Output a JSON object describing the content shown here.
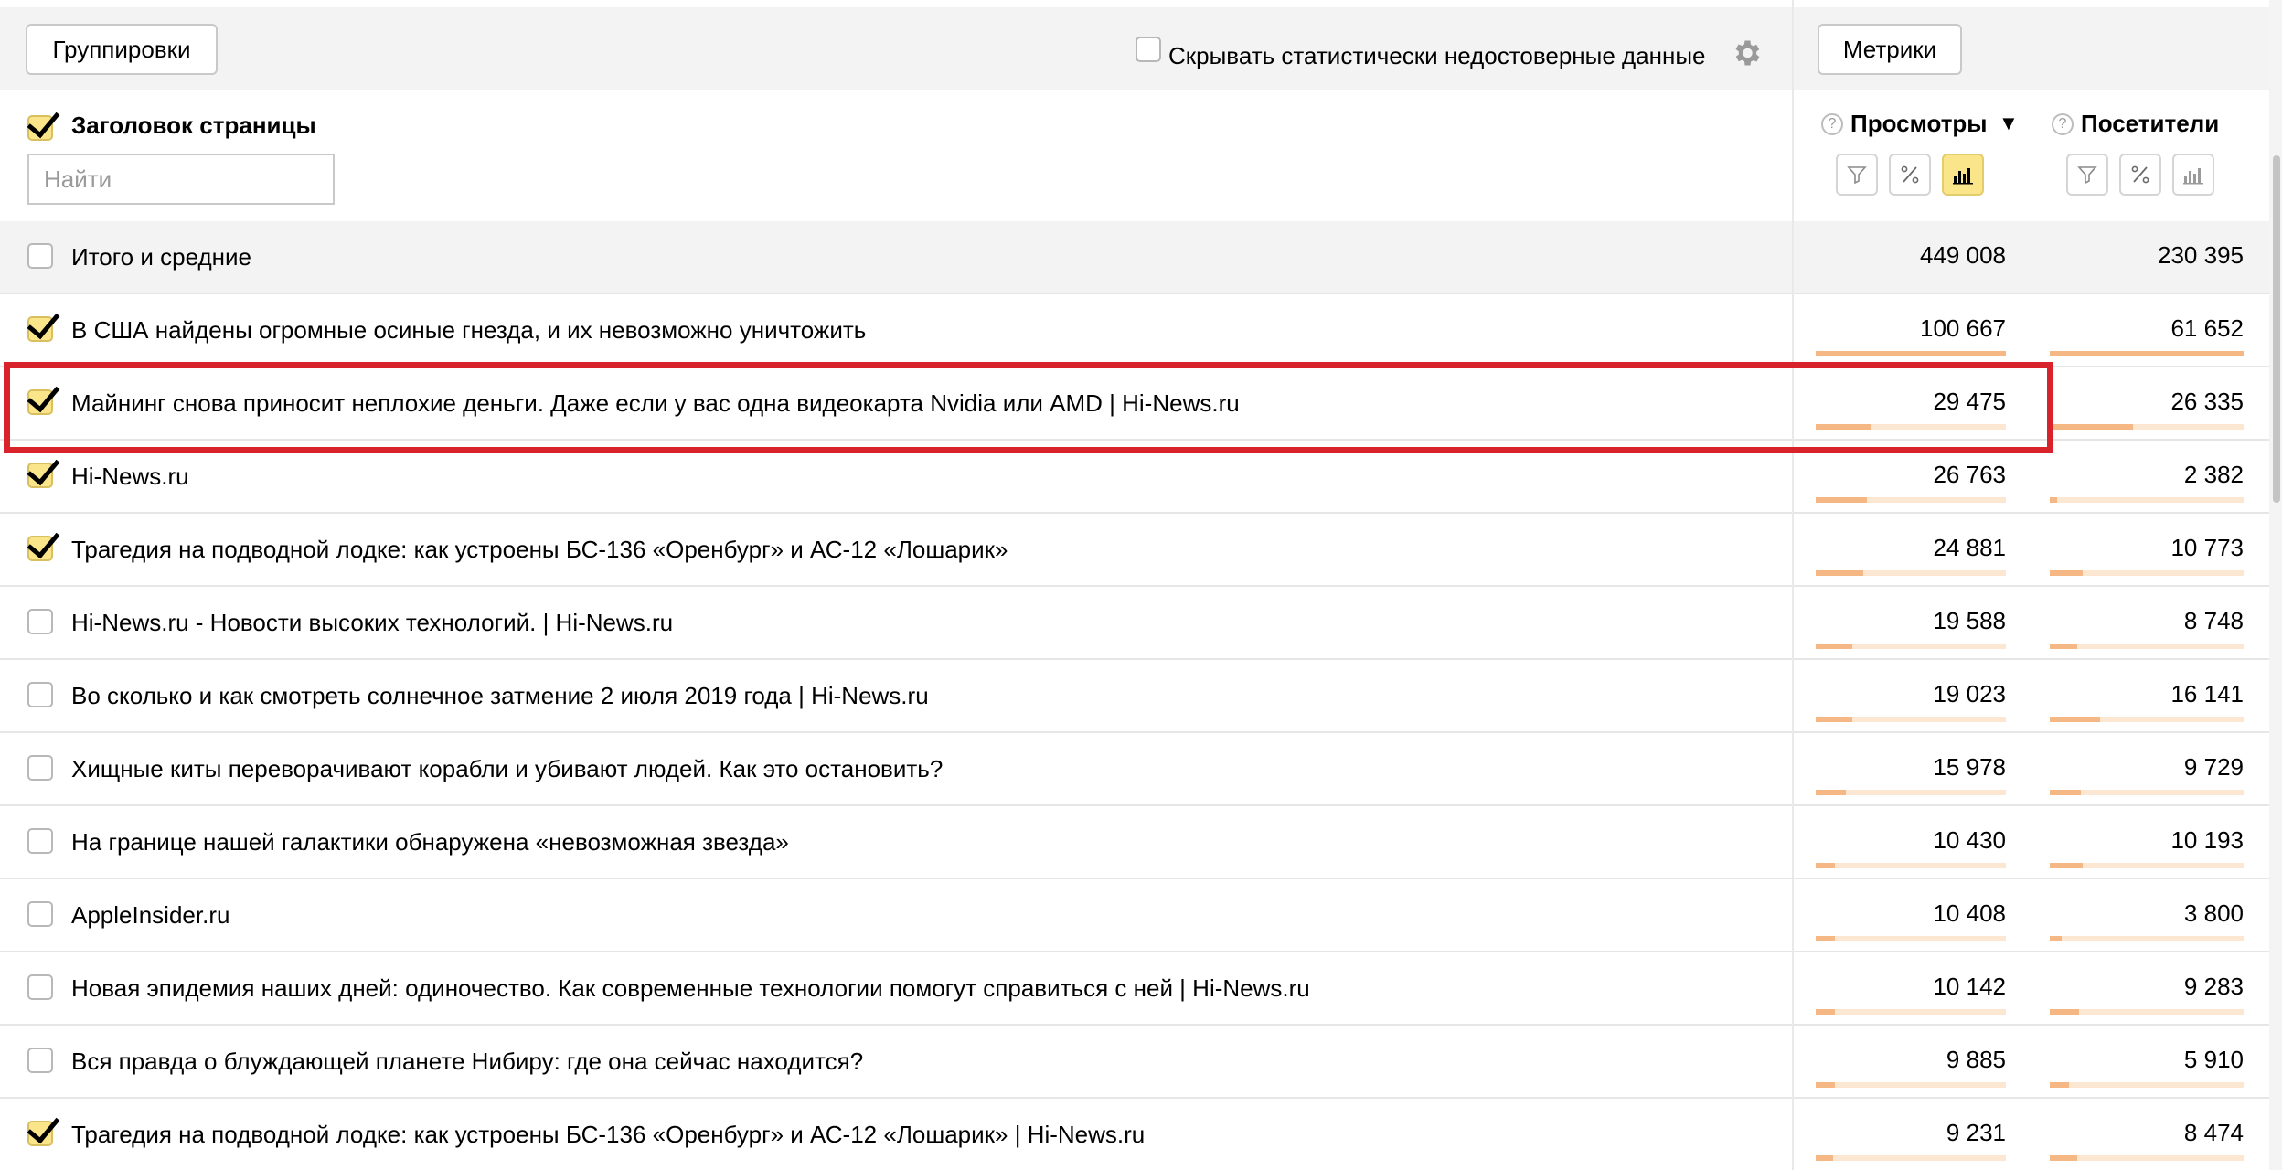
{
  "toolbar": {
    "groupings_label": "Группировки",
    "hide_unreliable_label": "Скрывать статистически недостоверные данные",
    "metrics_label": "Метрики"
  },
  "header": {
    "dimension_title": "Заголовок страницы",
    "search_placeholder": "Найти",
    "metrics": [
      {
        "label": "Просмотры",
        "sort_icon": "▼",
        "active_mode": "bars"
      },
      {
        "label": "Посетители",
        "active_mode": "none"
      }
    ]
  },
  "rows": [
    {
      "title": "Итого и средние",
      "checked": false,
      "views": "449 008",
      "visitors": "230 395",
      "total": true
    },
    {
      "title": "В США найдены огромные осиные гнезда, и их невозможно уничтожить",
      "checked": true,
      "views": "100 667",
      "visitors": "61 652",
      "views_share": 1.0,
      "visitors_share": 1.0
    },
    {
      "title": "Майнинг снова приносит неплохие деньги. Даже если у вас одна видеокарта Nvidia или AMD | Hi-News.ru",
      "checked": true,
      "views": "29 475",
      "visitors": "26 335",
      "views_share": 0.29,
      "visitors_share": 0.43
    },
    {
      "title": "Hi-News.ru",
      "checked": true,
      "views": "26 763",
      "visitors": "2 382",
      "views_share": 0.27,
      "visitors_share": 0.04
    },
    {
      "title": "Трагедия на подводной лодке: как устроены БС-136 «Оренбург» и АС-12 «Лошарик»",
      "checked": true,
      "views": "24 881",
      "visitors": "10 773",
      "views_share": 0.25,
      "visitors_share": 0.17
    },
    {
      "title": "Hi-News.ru - Новости высоких технологий. | Hi-News.ru",
      "checked": false,
      "views": "19 588",
      "visitors": "8 748",
      "views_share": 0.19,
      "visitors_share": 0.14
    },
    {
      "title": "Во сколько и как смотреть солнечное затмение 2 июля 2019 года | Hi-News.ru",
      "checked": false,
      "views": "19 023",
      "visitors": "16 141",
      "views_share": 0.19,
      "visitors_share": 0.26
    },
    {
      "title": "Хищные киты переворачивают корабли и убивают людей. Как это остановить?",
      "checked": false,
      "views": "15 978",
      "visitors": "9 729",
      "views_share": 0.16,
      "visitors_share": 0.16
    },
    {
      "title": "На границе нашей галактики обнаружена «невозможная звезда»",
      "checked": false,
      "views": "10 430",
      "visitors": "10 193",
      "views_share": 0.1,
      "visitors_share": 0.17
    },
    {
      "title": "AppleInsider.ru",
      "checked": false,
      "views": "10 408",
      "visitors": "3 800",
      "views_share": 0.1,
      "visitors_share": 0.06
    },
    {
      "title": "Новая эпидемия наших дней: одиночество. Как современные технологии помогут справиться с ней | Hi-News.ru",
      "checked": false,
      "views": "10 142",
      "visitors": "9 283",
      "views_share": 0.1,
      "visitors_share": 0.15
    },
    {
      "title": "Вся правда о блуждающей планете Нибиру: где она сейчас находится?",
      "checked": false,
      "views": "9 885",
      "visitors": "5 910",
      "views_share": 0.1,
      "visitors_share": 0.1
    },
    {
      "title": "Трагедия на подводной лодке: как устроены БС-136 «Оренбург» и АС-12 «Лошарик» | Hi-News.ru",
      "checked": true,
      "views": "9 231",
      "visitors": "8 474",
      "views_share": 0.09,
      "visitors_share": 0.14
    }
  ],
  "colors": {
    "highlight": "#d9232c",
    "checkbox_checked": "#fbe58a",
    "bar_fill": "#f5b784",
    "bar_bg": "#fbe7d2"
  },
  "icons": [
    "gear-icon",
    "help-icon",
    "filter-icon",
    "percent-icon",
    "bars-icon",
    "sort-desc-icon"
  ]
}
